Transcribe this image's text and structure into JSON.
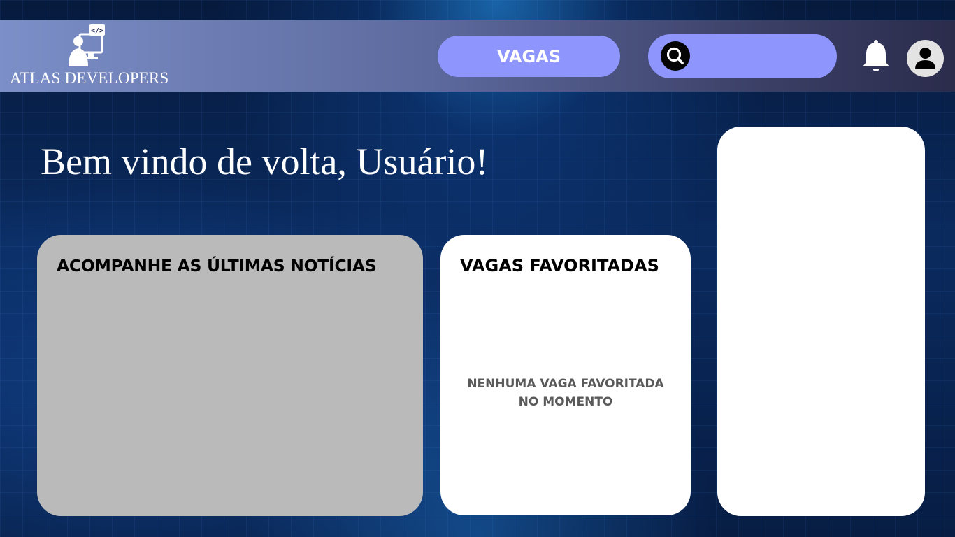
{
  "brand": {
    "name": "ATLAS DEVELOPERS",
    "logo_icon": "developer-workstation-icon",
    "code_badge": "</>"
  },
  "header": {
    "nav_button_label": "VAGAS",
    "search": {
      "placeholder": "",
      "value": "",
      "icon": "search-icon"
    },
    "notifications_icon": "bell-icon",
    "profile_icon": "user-avatar-icon"
  },
  "welcome": {
    "title": "Bem vindo de volta, Usuário!"
  },
  "news": {
    "title": "ACOMPANHE AS ÚLTIMAS NOTÍCIAS"
  },
  "favorites": {
    "title": "VAGAS FAVORITADAS",
    "empty_line1": "NENHUMA VAGA FAVORITADA",
    "empty_line2": "NO MOMENTO"
  },
  "colors": {
    "accent": "#8e96fd",
    "card_white": "#ffffff",
    "card_gray": "#bababa",
    "header_start": "#7c8fc8",
    "header_end": "#2b2c4c"
  }
}
